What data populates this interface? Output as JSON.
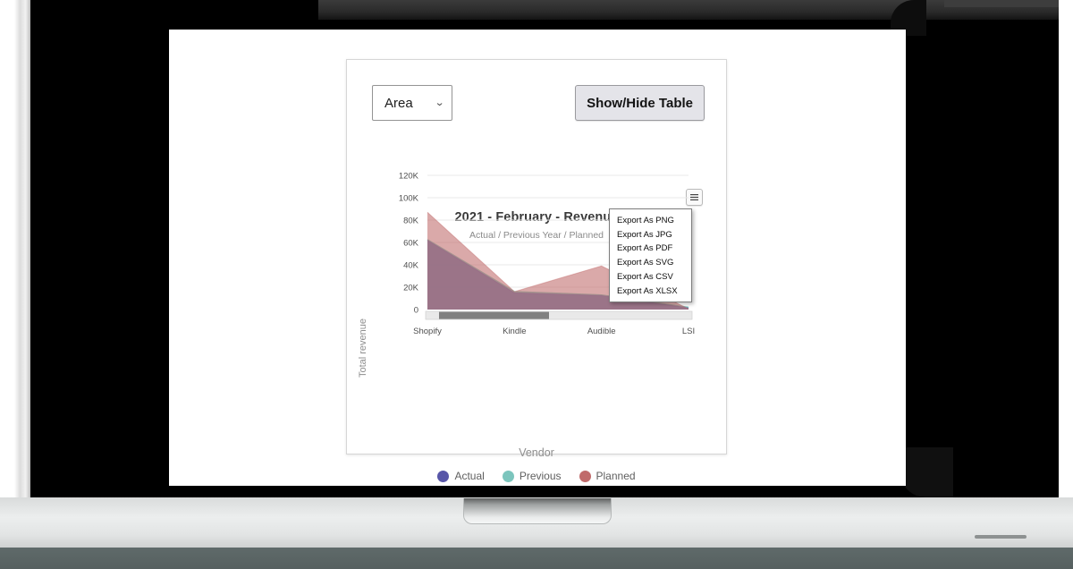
{
  "device": {
    "name": "laptop-mockup"
  },
  "toolbar": {
    "chart_type_value": "Area",
    "chart_type_options": [
      "Area"
    ],
    "chevron": "⌄",
    "show_hide_table_label": "Show/Hide Table"
  },
  "chart_menu": {
    "button_icon": "hamburger-icon",
    "items": [
      "Export As PNG",
      "Export As JPG",
      "Export As PDF",
      "Export As SVG",
      "Export As CSV",
      "Export As XLSX"
    ]
  },
  "legend": {
    "items": [
      {
        "label": "Actual",
        "color": "#5856a8"
      },
      {
        "label": "Previous",
        "color": "#7cc5bd"
      },
      {
        "label": "Planned",
        "color": "#c06b6b"
      }
    ]
  },
  "scrollbar": {
    "thumb_color": "#808080",
    "track_color": "#e9e9e9"
  },
  "chart_data": {
    "type": "area",
    "title": "2021 - February - Revenue",
    "subtitle": "Actual / Previous Year / Planned",
    "xlabel": "Vendor",
    "ylabel": "Total revenue",
    "categories": [
      "Shopify",
      "Kindle",
      "Audible",
      "LSI"
    ],
    "yticks": [
      "0",
      "20K",
      "40K",
      "60K",
      "80K",
      "100K",
      "120K"
    ],
    "ylim": [
      0,
      120000
    ],
    "grid": true,
    "legend_position": "bottom",
    "series": [
      {
        "name": "Actual",
        "color": "#5856a8",
        "values": [
          62000,
          15000,
          12500,
          1500
        ]
      },
      {
        "name": "Previous",
        "color": "#7cc5bd",
        "values": [
          62500,
          16000,
          13000,
          2000
        ]
      },
      {
        "name": "Planned",
        "color": "#c06b6b",
        "values": [
          87000,
          16000,
          39000,
          600
        ]
      }
    ]
  }
}
